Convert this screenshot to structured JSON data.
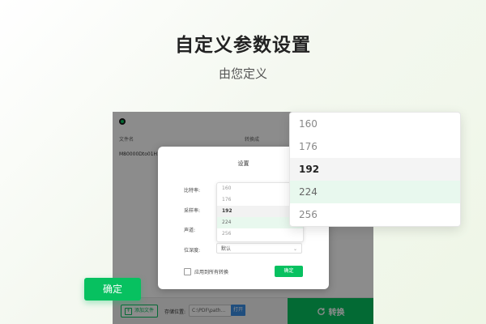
{
  "hero": {
    "title": "自定义参数设置",
    "subtitle": "由您定义"
  },
  "app": {
    "columns": {
      "filename": "文件名",
      "convert_to": "转换成"
    },
    "file_row": "M80000Dto01H11",
    "footer": {
      "add_file": "添加文件",
      "save_location_label": "存储位置:",
      "path_value": "C:\\PDF\\path...",
      "open": "打开",
      "convert": "转换"
    }
  },
  "dialog": {
    "title": "设置",
    "labels": {
      "bitrate": "比特率:",
      "sample_rate": "采样率:",
      "channel": "声道:",
      "bit_depth": "位深度:"
    },
    "options": [
      "160",
      "176",
      "192",
      "224",
      "256"
    ],
    "selected_option": "192",
    "hovered_option": "224",
    "bit_depth_value": "默认",
    "apply_all": "应用到所有转换",
    "ok": "确定"
  },
  "callouts": {
    "ok": "确定",
    "options": [
      "160",
      "176",
      "192",
      "224",
      "256"
    ]
  },
  "colors": {
    "accent": "#07c160",
    "link": "#3a8ee6"
  }
}
